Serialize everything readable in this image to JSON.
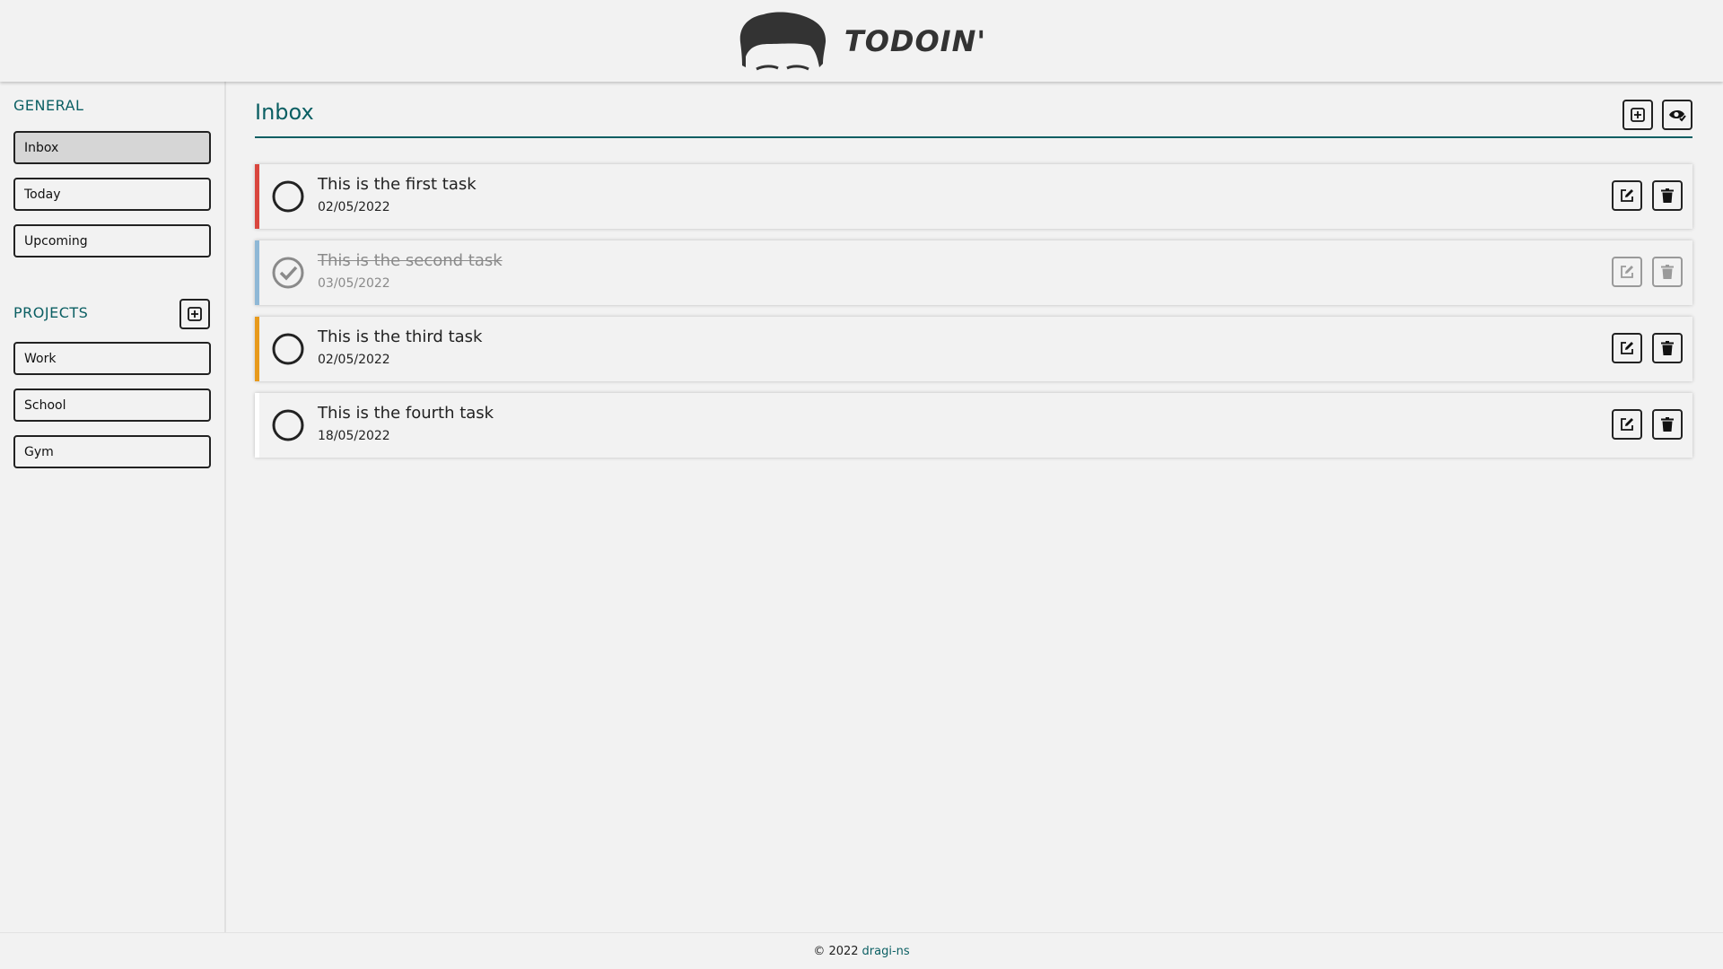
{
  "header": {
    "logo_text": "TODOIN'",
    "logo_icon": "hair-head-icon"
  },
  "sidebar": {
    "general_title": "GENERAL",
    "general_items": [
      {
        "label": "Inbox",
        "active": true
      },
      {
        "label": "Today",
        "active": false
      },
      {
        "label": "Upcoming",
        "active": false
      }
    ],
    "projects_title": "PROJECTS",
    "add_project_icon": "plus-square-icon",
    "projects": [
      {
        "label": "Work"
      },
      {
        "label": "School"
      },
      {
        "label": "Gym"
      }
    ]
  },
  "main": {
    "title": "Inbox",
    "add_task_icon": "plus-square-icon",
    "toggle_view_icon": "eye-check-icon",
    "tasks": [
      {
        "title": "This is the first task",
        "date": "02/05/2022",
        "done": false,
        "priority_color": "#d9463e"
      },
      {
        "title": "This is the second task",
        "date": "03/05/2022",
        "done": true,
        "priority_color": "#8fb8d6"
      },
      {
        "title": "This is the third task",
        "date": "02/05/2022",
        "done": false,
        "priority_color": "#e89a1c"
      },
      {
        "title": "This is the fourth task",
        "date": "18/05/2022",
        "done": false,
        "priority_color": "#ffffff"
      }
    ]
  },
  "footer": {
    "copyright": "© 2022",
    "author": "dragi-ns"
  },
  "colors": {
    "accent": "#0b5f63",
    "background": "#f2f2f2"
  }
}
